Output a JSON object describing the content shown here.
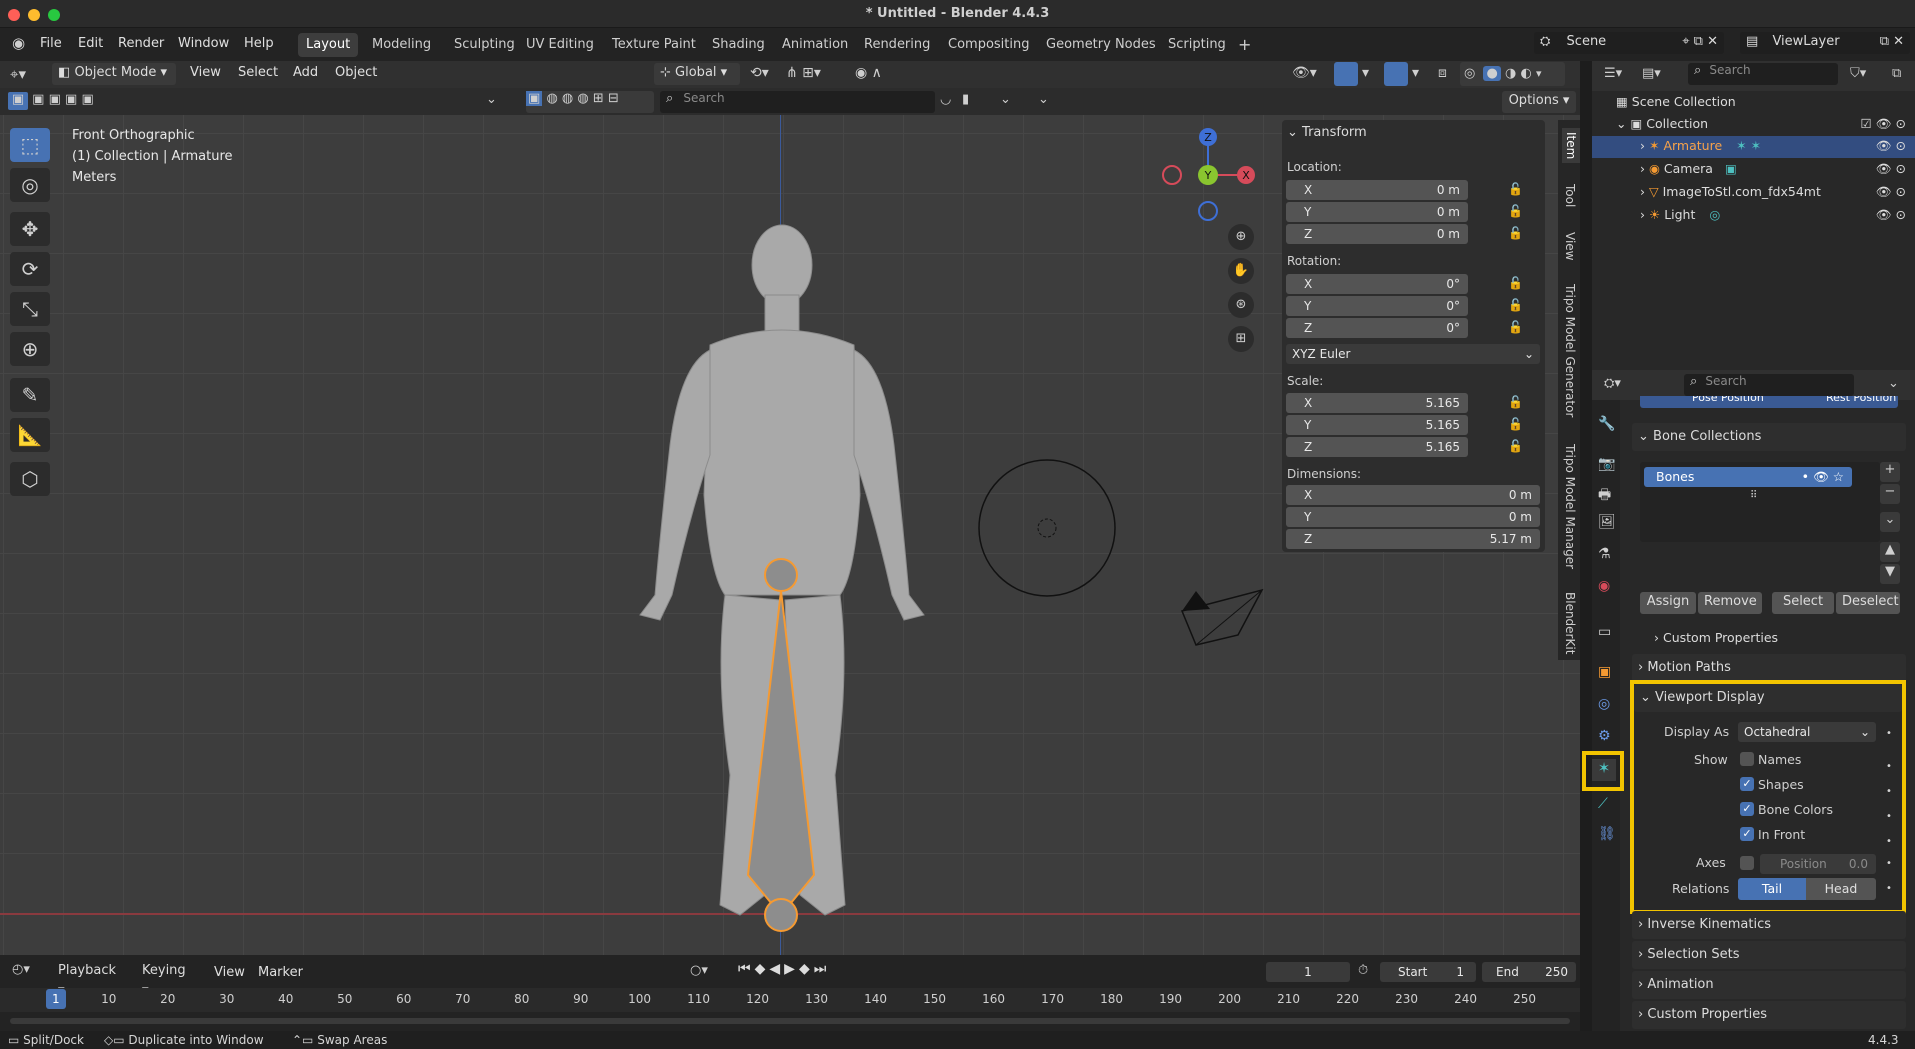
{
  "window": {
    "title": "* Untitled - Blender 4.4.3"
  },
  "menu": [
    "File",
    "Edit",
    "Render",
    "Window",
    "Help"
  ],
  "workspaces": [
    "Layout",
    "Modeling",
    "Sculpting",
    "UV Editing",
    "Texture Paint",
    "Shading",
    "Animation",
    "Rendering",
    "Compositing",
    "Geometry Nodes",
    "Scripting"
  ],
  "scene": {
    "name": "Scene",
    "view_layer": "ViewLayer"
  },
  "viewport_header": {
    "mode": "Object Mode",
    "items": [
      "View",
      "Select",
      "Add",
      "Object"
    ],
    "orientation": "Global",
    "options": "Options",
    "search_placeholder": "Search"
  },
  "viewport": {
    "view_name": "Front Orthographic",
    "collection_info": "(1) Collection | Armature",
    "units": "Meters"
  },
  "gizmo": {
    "z": "Z",
    "y": "Y",
    "x": "X"
  },
  "npanel": {
    "title": "Transform",
    "location_label": "Location:",
    "location": [
      {
        "axis": "X",
        "value": "0 m"
      },
      {
        "axis": "Y",
        "value": "0 m"
      },
      {
        "axis": "Z",
        "value": "0 m"
      }
    ],
    "rotation_label": "Rotation:",
    "rotation": [
      {
        "axis": "X",
        "value": "0°"
      },
      {
        "axis": "Y",
        "value": "0°"
      },
      {
        "axis": "Z",
        "value": "0°"
      }
    ],
    "rotation_mode": "XYZ Euler",
    "scale_label": "Scale:",
    "scale": [
      {
        "axis": "X",
        "value": "5.165"
      },
      {
        "axis": "Y",
        "value": "5.165"
      },
      {
        "axis": "Z",
        "value": "5.165"
      }
    ],
    "dimensions_label": "Dimensions:",
    "dimensions": [
      {
        "axis": "X",
        "value": "0 m"
      },
      {
        "axis": "Y",
        "value": "0 m"
      },
      {
        "axis": "Z",
        "value": "5.17 m"
      }
    ],
    "tabs": [
      "Item",
      "Tool",
      "View",
      "Tripo Model Generator",
      "Tripo Model Manager",
      "BlenderKit"
    ]
  },
  "outliner": {
    "search_placeholder": "Search",
    "scene_collection": "Scene Collection",
    "collection": "Collection",
    "items": [
      {
        "name": "Armature",
        "selected": true
      },
      {
        "name": "Camera"
      },
      {
        "name": "ImageToStl.com_fdx54mt"
      },
      {
        "name": "Light"
      }
    ]
  },
  "properties": {
    "search_placeholder": "Search",
    "pose_tabs": [
      "Pose Position",
      "Rest Position"
    ],
    "bone_collections": "Bone Collections",
    "bones_item": "Bones",
    "buttons": [
      "Assign",
      "Remove",
      "Select",
      "Deselect"
    ],
    "custom_properties_sub": "Custom Properties",
    "motion_paths": "Motion Paths",
    "viewport_display": "Viewport Display",
    "display_as_label": "Display As",
    "display_as_value": "Octahedral",
    "show_label": "Show",
    "show_items": [
      {
        "label": "Names",
        "checked": false
      },
      {
        "label": "Shapes",
        "checked": true
      },
      {
        "label": "Bone Colors",
        "checked": true
      },
      {
        "label": "In Front",
        "checked": true
      }
    ],
    "axes_label": "Axes",
    "axes_position_label": "Position",
    "axes_position_value": "0.0",
    "relations_label": "Relations",
    "relations_options": [
      "Tail",
      "Head"
    ],
    "collapsed_sections": [
      "Inverse Kinematics",
      "Selection Sets",
      "Animation",
      "Custom Properties"
    ],
    "highlight_color": "#f2c400"
  },
  "timeline": {
    "menus": [
      "Playback",
      "Keying",
      "View",
      "Marker"
    ],
    "current_frame": "1",
    "start_label": "Start",
    "start": "1",
    "end_label": "End",
    "end": "250",
    "ruler": [
      "1",
      "10",
      "20",
      "30",
      "40",
      "50",
      "60",
      "70",
      "80",
      "90",
      "100",
      "110",
      "120",
      "130",
      "140",
      "150",
      "160",
      "170",
      "180",
      "190",
      "200",
      "210",
      "220",
      "230",
      "240",
      "250"
    ]
  },
  "statusbar": {
    "items": [
      "Split/Dock",
      "Duplicate into Window",
      "Swap Areas"
    ],
    "version": "4.4.3"
  }
}
